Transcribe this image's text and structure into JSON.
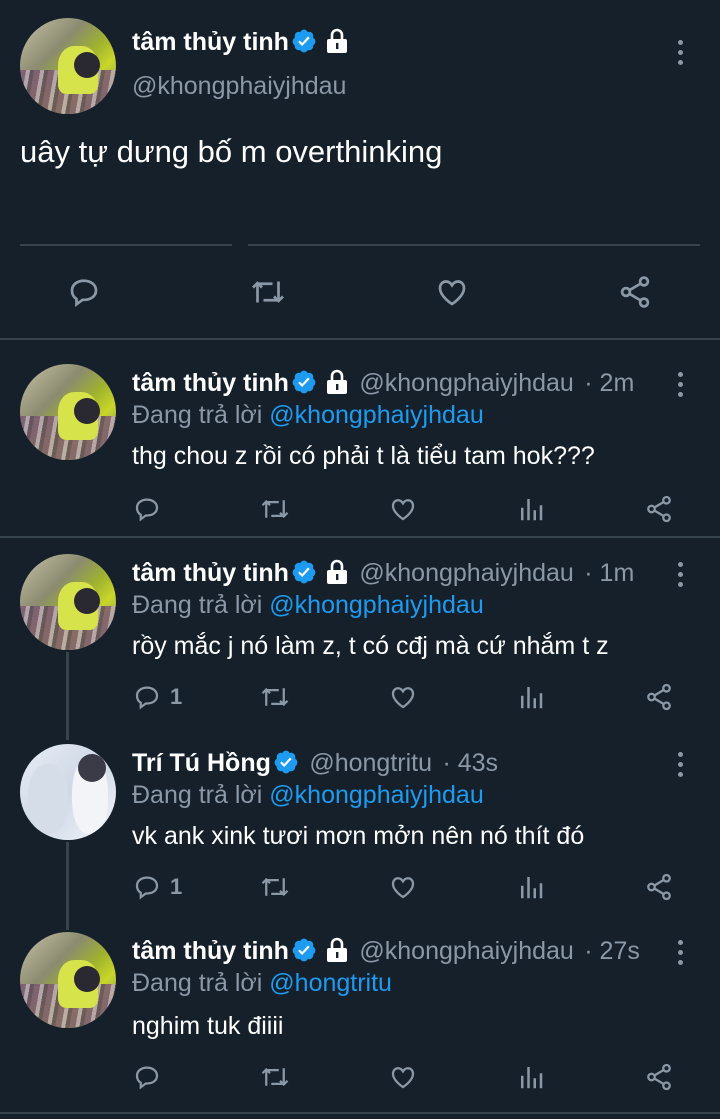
{
  "main_tweet": {
    "name": "tâm thủy tinh",
    "handle": "@khongphaiyjhdau",
    "text": "uây tự dưng bố m overthinking"
  },
  "replies": [
    {
      "name": "tâm thủy tinh",
      "handle": "@khongphaiyjhdau",
      "time": "· 2m",
      "replying_prefix": "Đang trả lời",
      "replying_to": "@khongphaiyjhdau",
      "text": "thg chou z rồi có phải t là tiểu tam hok???",
      "reply_count": ""
    },
    {
      "name": "tâm thủy tinh",
      "handle": "@khongphaiyjhdau",
      "time": "· 1m",
      "replying_prefix": "Đang trả lời",
      "replying_to": "@khongphaiyjhdau",
      "text": "rồy mắc j nó làm z, t có cđj mà cứ nhắm t z",
      "reply_count": "1"
    },
    {
      "name": "Trí Tú Hồng",
      "handle": "@hongtritu",
      "time": "· 43s",
      "replying_prefix": "Đang trả lời",
      "replying_to": "@khongphaiyjhdau",
      "text": "vk ank xink tươi mơn mởn nên nó thít đó",
      "reply_count": "1"
    },
    {
      "name": "tâm thủy tinh",
      "handle": "@khongphaiyjhdau",
      "time": "· 27s",
      "replying_prefix": "Đang trả lời",
      "replying_to": "@hongtritu",
      "text": "nghim tuk điiii",
      "reply_count": ""
    }
  ],
  "colors": {
    "background": "#15202b",
    "text": "#ffffff",
    "secondary": "#8b98a5",
    "accent": "#1d9bf0",
    "divider": "#38444d"
  },
  "icons": [
    "verified-badge-icon",
    "lock-icon",
    "more-icon",
    "reply-icon",
    "retweet-icon",
    "like-icon",
    "analytics-icon",
    "share-icon"
  ]
}
